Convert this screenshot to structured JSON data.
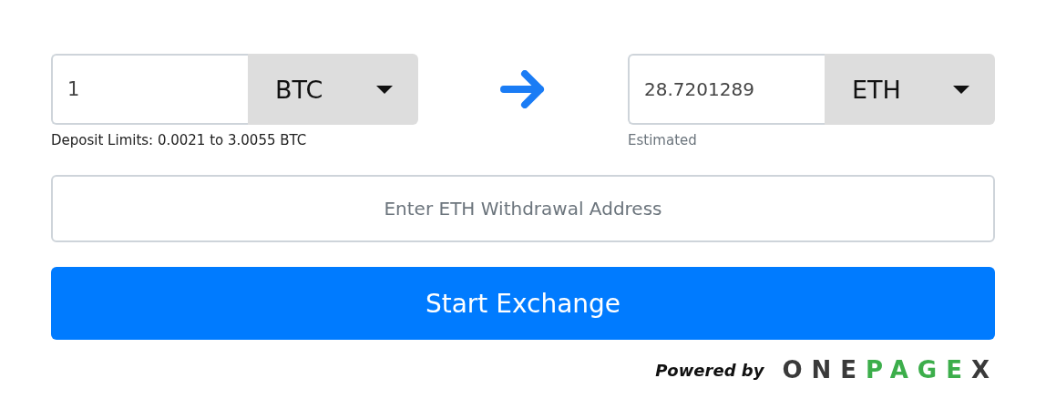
{
  "deposit": {
    "amount": "1",
    "currency": "BTC",
    "note": "Deposit Limits: 0.0021 to 3.0055 BTC"
  },
  "receive": {
    "amount": "28.7201289",
    "currency": "ETH",
    "note": "Estimated"
  },
  "address": {
    "placeholder": "Enter ETH Withdrawal Address"
  },
  "submit": "Start Exchange",
  "powered_by": "Powered by",
  "logo": [
    {
      "text": "ONE",
      "color": "#3a3a3a"
    },
    {
      "text": "PAGE",
      "color": "#3cae4b"
    },
    {
      "text": "X",
      "color": "#3a3a3a"
    }
  ]
}
